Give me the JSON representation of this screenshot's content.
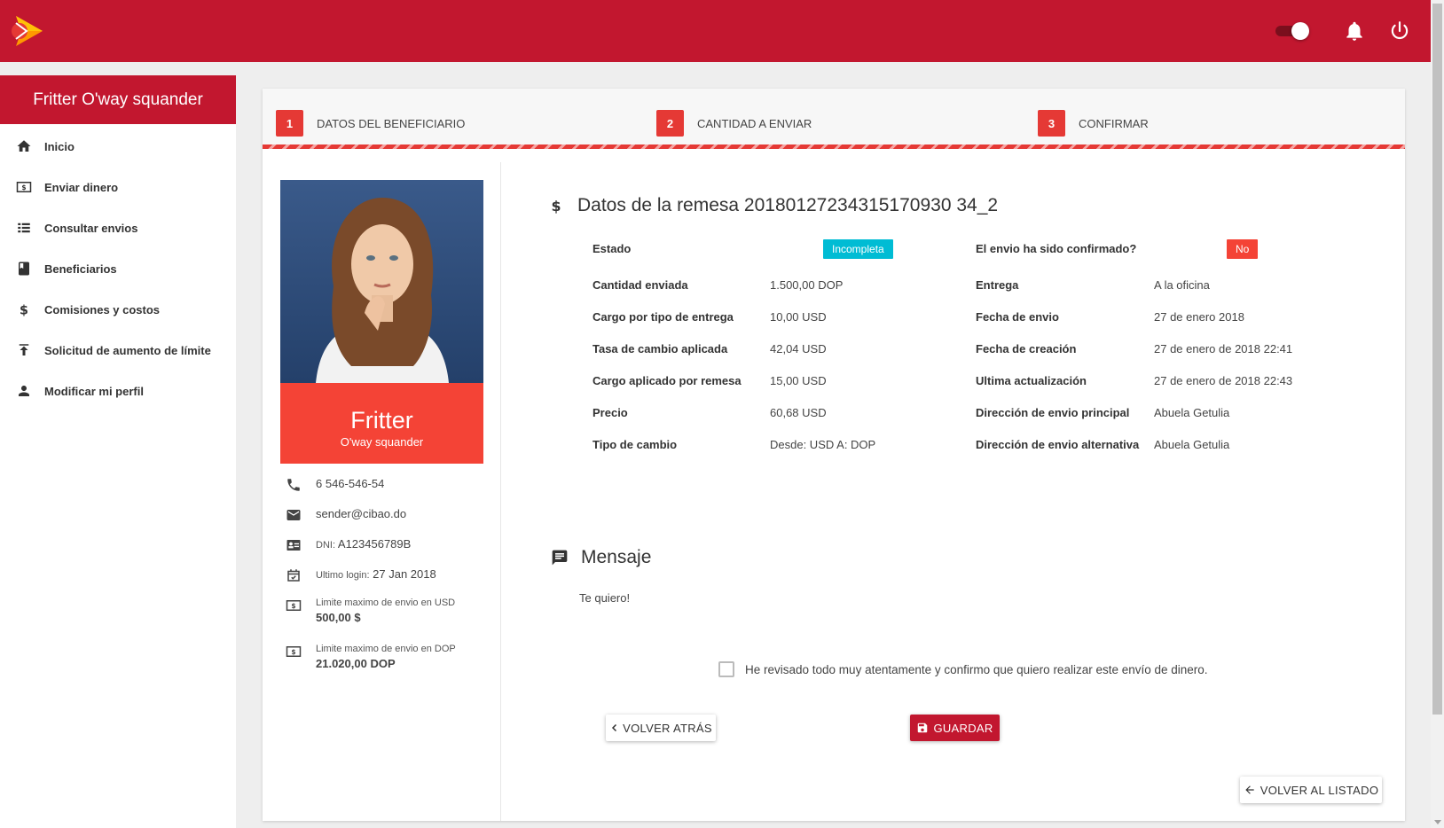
{
  "header": {
    "logo_icon": "play-arrow-logo-icon",
    "toggle_icon": "toggle-switch-icon",
    "bell_icon": "bell-icon",
    "power_icon": "power-icon",
    "brand_color": "#c2172f"
  },
  "sidebar": {
    "title": "Fritter O'way squander",
    "items": [
      {
        "label": "Inicio",
        "icon": "home-icon"
      },
      {
        "label": "Enviar dinero",
        "icon": "money-icon"
      },
      {
        "label": "Consultar envios",
        "icon": "list-icon"
      },
      {
        "label": "Beneficiarios",
        "icon": "book-icon"
      },
      {
        "label": "Comisiones y costos",
        "icon": "dollar-icon"
      },
      {
        "label": "Solicitud de aumento de límite",
        "icon": "upload-icon"
      },
      {
        "label": "Modificar mi perfil",
        "icon": "person-icon"
      }
    ]
  },
  "steps": [
    {
      "num": "1",
      "label": "DATOS DEL BENEFICIARIO"
    },
    {
      "num": "2",
      "label": "CANTIDAD A ENVIAR"
    },
    {
      "num": "3",
      "label": "CONFIRMAR"
    }
  ],
  "profile": {
    "first_name": "Fritter",
    "last_name": "O'way squander",
    "phone": "6 546-546-54",
    "email": "sender@cibao.do",
    "dni_label": "DNI:",
    "dni": "A123456789B",
    "last_login_label": "Ultimo login:",
    "last_login": "27 Jan 2018",
    "limit_usd_label": "Limite maximo de envio en USD",
    "limit_usd": "500,00 $",
    "limit_dop_label": "Limite maximo de envio en DOP",
    "limit_dop": "21.020,00 DOP"
  },
  "remittance": {
    "title": "Datos de la remesa 20180127234315170930 34_2",
    "left": [
      {
        "label": "Estado",
        "value": "Incompleta"
      },
      {
        "label": "Cantidad enviada",
        "value": "1.500,00 DOP"
      },
      {
        "label": "Cargo por tipo de entrega",
        "value": "10,00 USD"
      },
      {
        "label": "Tasa de cambio aplicada",
        "value": "42,04 USD"
      },
      {
        "label": "Cargo aplicado por remesa",
        "value": "15,00 USD"
      },
      {
        "label": "Precio",
        "value": "60,68 USD"
      },
      {
        "label": "Tipo de cambio",
        "value": "Desde: USD A: DOP"
      }
    ],
    "right": [
      {
        "label": "El envio ha sido confirmado?",
        "value": "No"
      },
      {
        "label": "Entrega",
        "value": "A la oficina"
      },
      {
        "label": "Fecha de envio",
        "value": "27 de enero 2018"
      },
      {
        "label": "Fecha de creación",
        "value": "27 de enero de 2018 22:41"
      },
      {
        "label": "Ultima actualización",
        "value": "27 de enero de 2018 22:43"
      },
      {
        "label": "Dirección de envio principal",
        "value": "Abuela Getulia"
      },
      {
        "label": "Dirección de envio alternativa",
        "value": "Abuela Getulia"
      }
    ]
  },
  "message": {
    "title": "Mensaje",
    "text": "Te quiero!"
  },
  "confirm_text": "He revisado todo muy atentamente y confirmo que quiero realizar este envío de dinero.",
  "buttons": {
    "back": "VOLVER ATRÁS",
    "save": "GUARDAR",
    "back_list": "VOLVER AL LISTADO"
  }
}
